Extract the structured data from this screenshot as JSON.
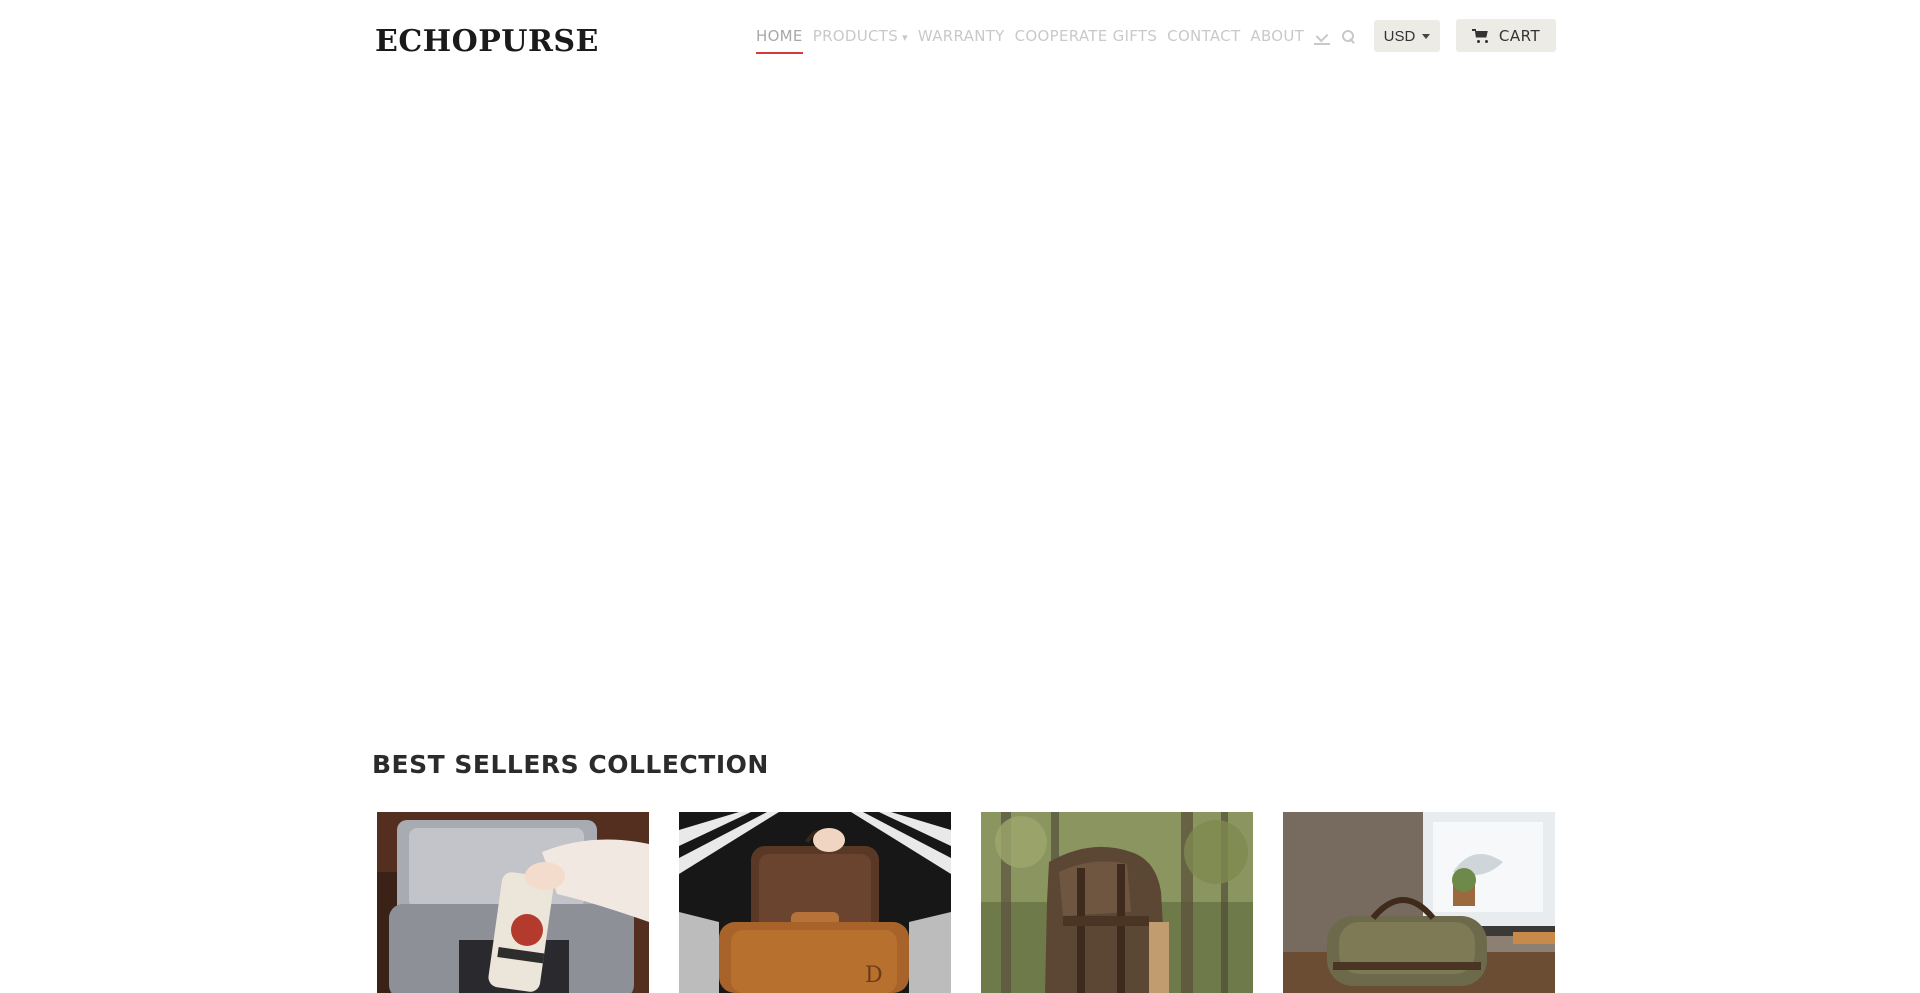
{
  "brand": {
    "logo_text": "ECHOPURSE"
  },
  "nav": {
    "items": [
      {
        "label": "HOME",
        "active": true
      },
      {
        "label": "PRODUCTS",
        "has_dropdown": true
      },
      {
        "label": "WARRANTY"
      },
      {
        "label": "COOPERATE GIFTS"
      },
      {
        "label": "CONTACT"
      },
      {
        "label": "ABOUT"
      }
    ],
    "icons": [
      "account-icon",
      "search-icon"
    ],
    "caret_glyph": "▾"
  },
  "currency": {
    "selected": "USD"
  },
  "cart": {
    "label": "CART",
    "icon": "cart-icon"
  },
  "section": {
    "title": "BEST SELLERS COLLECTION"
  },
  "products": [
    {
      "image": "cooler-bag-photo"
    },
    {
      "image": "leather-toiletry-bag-photo"
    },
    {
      "image": "canvas-backpack-forest-photo"
    },
    {
      "image": "duffel-bag-window-photo"
    }
  ],
  "colors": {
    "accent_underline": "#d23b3b",
    "button_bg": "#ecebe6",
    "nav_text": "#c9c9c9"
  }
}
